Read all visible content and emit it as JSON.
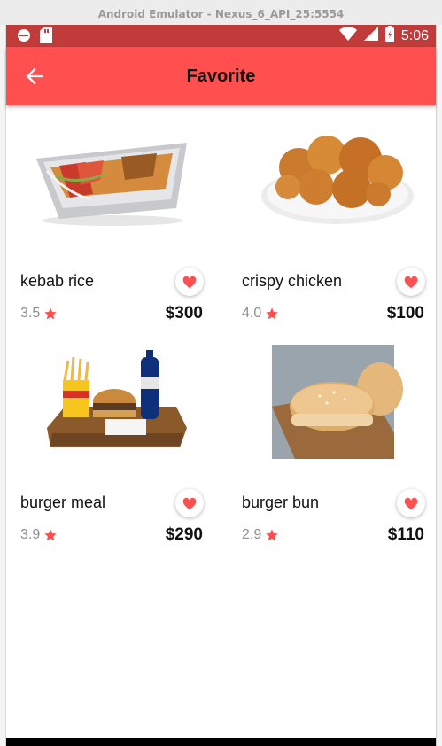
{
  "window": {
    "title": "Android Emulator - Nexus_6_API_25:5554"
  },
  "status_bar": {
    "time": "5:06"
  },
  "app_bar": {
    "title": "Favorite"
  },
  "items": [
    {
      "name": "kebab rice",
      "rating": "3.5",
      "price": "$300",
      "favorited": true
    },
    {
      "name": "crispy chicken",
      "rating": "4.0",
      "price": "$100",
      "favorited": true
    },
    {
      "name": "burger meal",
      "rating": "3.9",
      "price": "$290",
      "favorited": true
    },
    {
      "name": "burger bun",
      "rating": "2.9",
      "price": "$110",
      "favorited": true
    }
  ],
  "colors": {
    "primary": "#ff4f4f",
    "status_bar": "#c23b3b",
    "accent": "#ff4f4f"
  }
}
